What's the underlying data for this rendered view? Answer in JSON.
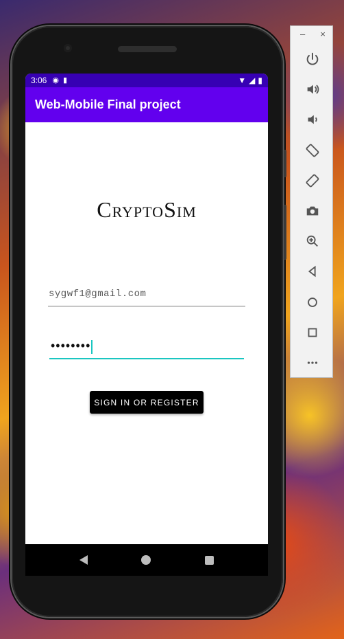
{
  "status_bar": {
    "time": "3:06"
  },
  "app_bar": {
    "title": "Web-Mobile Final project"
  },
  "logo": {
    "text": "CryptoSim"
  },
  "email_field": {
    "value": "sygwf1@gmail.com"
  },
  "password_field": {
    "value": "••••••••"
  },
  "signin_button": {
    "label": "SIGN IN OR REGISTER"
  },
  "emulator_toolbar": {
    "minimize": "–",
    "close": "×",
    "tools": [
      "power",
      "volume-up",
      "volume-down",
      "rotate-left",
      "rotate-right",
      "screenshot",
      "zoom",
      "back",
      "home",
      "overview",
      "more"
    ]
  },
  "colors": {
    "status_bar": "#3700b3",
    "app_bar": "#6200ee",
    "accent": "#1ac6c1"
  }
}
